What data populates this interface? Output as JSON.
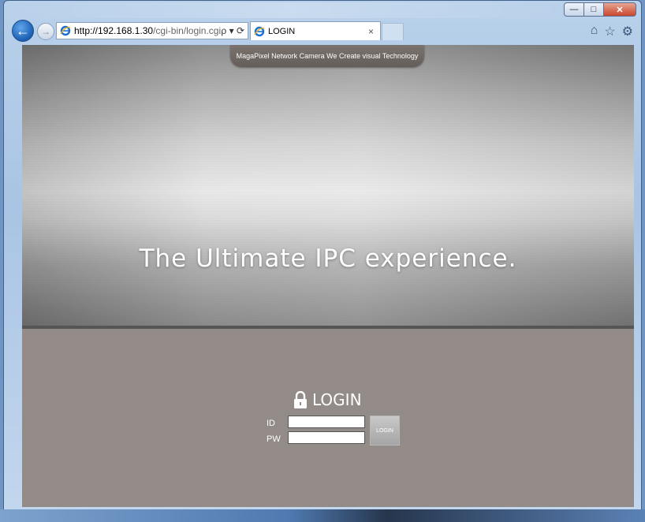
{
  "browser": {
    "address_host": "http://192.168.1.30",
    "address_path": "/cgi-bin/login.cgi",
    "tab_title": "LOGIN",
    "tab_close": "×",
    "search_symbol": "ρ ▾ ⟳"
  },
  "window_controls": {
    "minimize": "—",
    "maximize": "□",
    "close": "✕"
  },
  "page": {
    "tagline": "MagaPixel Network Camera We Create visual Technology",
    "headline": "The Ultimate IPC experience.",
    "login": {
      "title": "LOGIN",
      "id_label": "ID",
      "pw_label": "PW",
      "id_value": "",
      "pw_value": "",
      "button_label": "LOGIN"
    }
  },
  "icons": {
    "back": "back-arrow-icon",
    "forward": "forward-arrow-icon",
    "ie": "internet-explorer-icon",
    "home": "home-icon",
    "favorites": "star-icon",
    "settings": "gear-icon",
    "lock": "lock-icon"
  },
  "colors": {
    "panel_gray": "#928b87",
    "ie_blue": "#1b5fb3"
  }
}
